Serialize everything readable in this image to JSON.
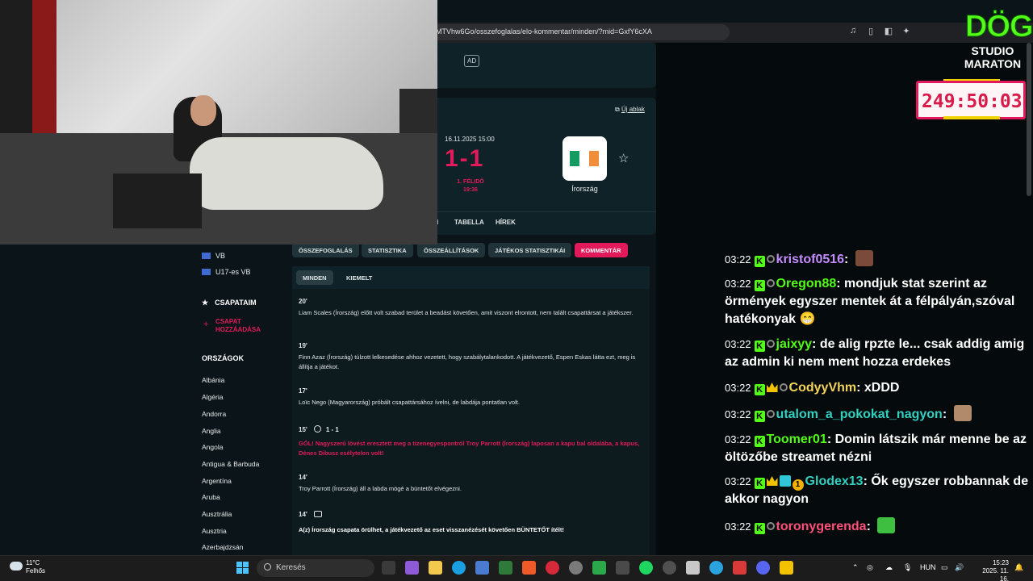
{
  "browser": {
    "url": "MTVhw6Go/osszefoglalas/elo-kommentar/minden/?mid=GxfY6cXA"
  },
  "ad": {
    "tag": "AD"
  },
  "sidebar": {
    "competitions": [
      "VB",
      "U17-es VB"
    ],
    "my_teams_heading": "CSAPATAIM",
    "add_team": "CSAPAT HOZZÁADÁSA",
    "countries_heading": "ORSZÁGOK",
    "countries": [
      "Albánia",
      "Algéria",
      "Andorra",
      "Anglia",
      "Angola",
      "Antigua & Barbuda",
      "Argentína",
      "Aruba",
      "Ausztrália",
      "Ausztria",
      "Azerbajdzsán"
    ]
  },
  "match": {
    "new_window": "Új ablak",
    "date": "16.11.2025 15:00",
    "score": "1-1",
    "period": "1. FÉLIDŐ",
    "clock": "19:36",
    "team_right": "Írország",
    "tabs": [
      "TABELLA",
      "HÍREK"
    ],
    "tab_partial": "I"
  },
  "subnav": {
    "pills": [
      "ÖSSZEFOGLALÁS",
      "STATISZTIKA",
      "ÖSSZEÁLLÍTÁSOK",
      "JÁTÉKOS STATISZTIKÁI",
      "KOMMENTÁR"
    ],
    "filters": [
      "MINDEN",
      "KIEMELT"
    ]
  },
  "commentary": [
    {
      "minute": "20'",
      "text": "Liam Scales (Írország) előtt volt szabad terület a beadást követően, amit viszont elrontott, nem talált csapattársat a játékszer."
    },
    {
      "minute": "19'",
      "text": "Finn Azaz (Írország) túlzott lelkesedése ahhoz vezetett, hogy szabálytalankodott. A játékvezető, Espen Eskas látta ezt, meg is állítja a játékot."
    },
    {
      "minute": "17'",
      "text": "Loïc Nego (Magyarország) próbált csapattársához ívelni, de labdája pontatlan volt."
    },
    {
      "minute": "15'",
      "score": "1 - 1",
      "text": "GÓL! Nagyszerű lövést eresztett meg a tizenegyespontról Troy Parrott (Írország) laposan a kapu bal oldalába, a kapus, Dénes Dibusz esélytelen volt!"
    },
    {
      "minute": "14'",
      "text": "Troy Parrott (Írország) áll a labda mögé a büntetőt elvégezni."
    },
    {
      "minute": "14'",
      "text": "A(z) Írország csapata örülhet, a játékvezető az eset visszanézését követően BÜNTETŐT ítélt!"
    }
  ],
  "chat": [
    {
      "time": "03:22",
      "user": "kristof0516",
      "color": "#c58cff",
      "msg": "",
      "badges": [
        "kick",
        "sub"
      ],
      "emote": "#7a4a3a"
    },
    {
      "time": "03:22",
      "user": "Oregon88",
      "color": "#53fc18",
      "msg": "mondjuk stat szerint az örmények egyszer mentek át a félpályán,szóval hatékonyak 😁",
      "badges": [
        "kick",
        "sub"
      ]
    },
    {
      "time": "03:22",
      "user": "jaixyy",
      "color": "#53fc18",
      "msg": "de alig rpzte le... csak addig amig az admin ki nem ment hozza erdekes",
      "badges": [
        "kick",
        "sub"
      ]
    },
    {
      "time": "03:22",
      "user": "CodyyVhm",
      "color": "#f2d35b",
      "msg": "xDDD",
      "badges": [
        "kick",
        "crown",
        "sub"
      ]
    },
    {
      "time": "03:22",
      "user": "utalom_a_pokokat_nagyon",
      "color": "#31d0c0",
      "msg": "",
      "badges": [
        "kick",
        "sub"
      ],
      "emote": "#b08a6a"
    },
    {
      "time": "03:22",
      "user": "Toomer01",
      "color": "#53fc18",
      "msg": "Domin látszik már menne be az öltözőbe streamet nézni",
      "badges": [
        "kick"
      ]
    },
    {
      "time": "03:22",
      "user": "Glodex13",
      "color": "#31d0c0",
      "msg": "Ők egyszer robbannak de akkor nagyon",
      "badges": [
        "kick",
        "crown",
        "bits",
        "one"
      ]
    },
    {
      "time": "03:22",
      "user": "toronygerenda",
      "color": "#ff4f7a",
      "msg": "",
      "badges": [
        "kick",
        "sub"
      ],
      "emote": "#3fbf3f"
    }
  ],
  "overlay": {
    "logo_main": "DÖG",
    "logo_sub1": "STUDIO",
    "logo_sub2": "MARATON",
    "timer": "249:50:03"
  },
  "taskbar": {
    "temp": "11°C",
    "weather": "Felhős",
    "search": "Keresés",
    "lang": "HUN",
    "time": "15:23",
    "date": "2025. 11. 16."
  }
}
